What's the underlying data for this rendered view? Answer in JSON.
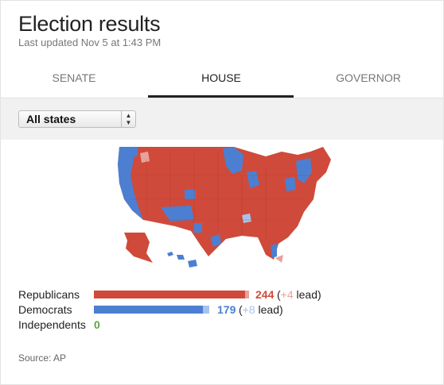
{
  "header": {
    "title": "Election results",
    "updated": "Last updated Nov 5 at 1:43 PM"
  },
  "tabs": [
    {
      "label": "SENATE",
      "active": false
    },
    {
      "label": "HOUSE",
      "active": true
    },
    {
      "label": "GOVERNOR",
      "active": false
    }
  ],
  "filter": {
    "selected": "All states"
  },
  "map": {
    "icon": "us-map",
    "colors": {
      "republican": "#cf4a3a",
      "democrat": "#4c7fd1",
      "lead_republican": "#e6a29b",
      "lead_democrat": "#a7c3ec"
    }
  },
  "results": [
    {
      "party": "Republicans",
      "seats": "244",
      "lead_open": "(",
      "lead_num": "+4",
      "lead_close": " lead)",
      "color": "#cf4a3a",
      "lead_color": "#e6a29b"
    },
    {
      "party": "Democrats",
      "seats": "179",
      "lead_open": "(",
      "lead_num": "+8",
      "lead_close": " lead)",
      "color": "#4c7fd1",
      "lead_color": "#a7c3ec"
    },
    {
      "party": "Independents",
      "seats": "0",
      "color": "#5aa544"
    }
  ],
  "source": "Source: AP"
}
